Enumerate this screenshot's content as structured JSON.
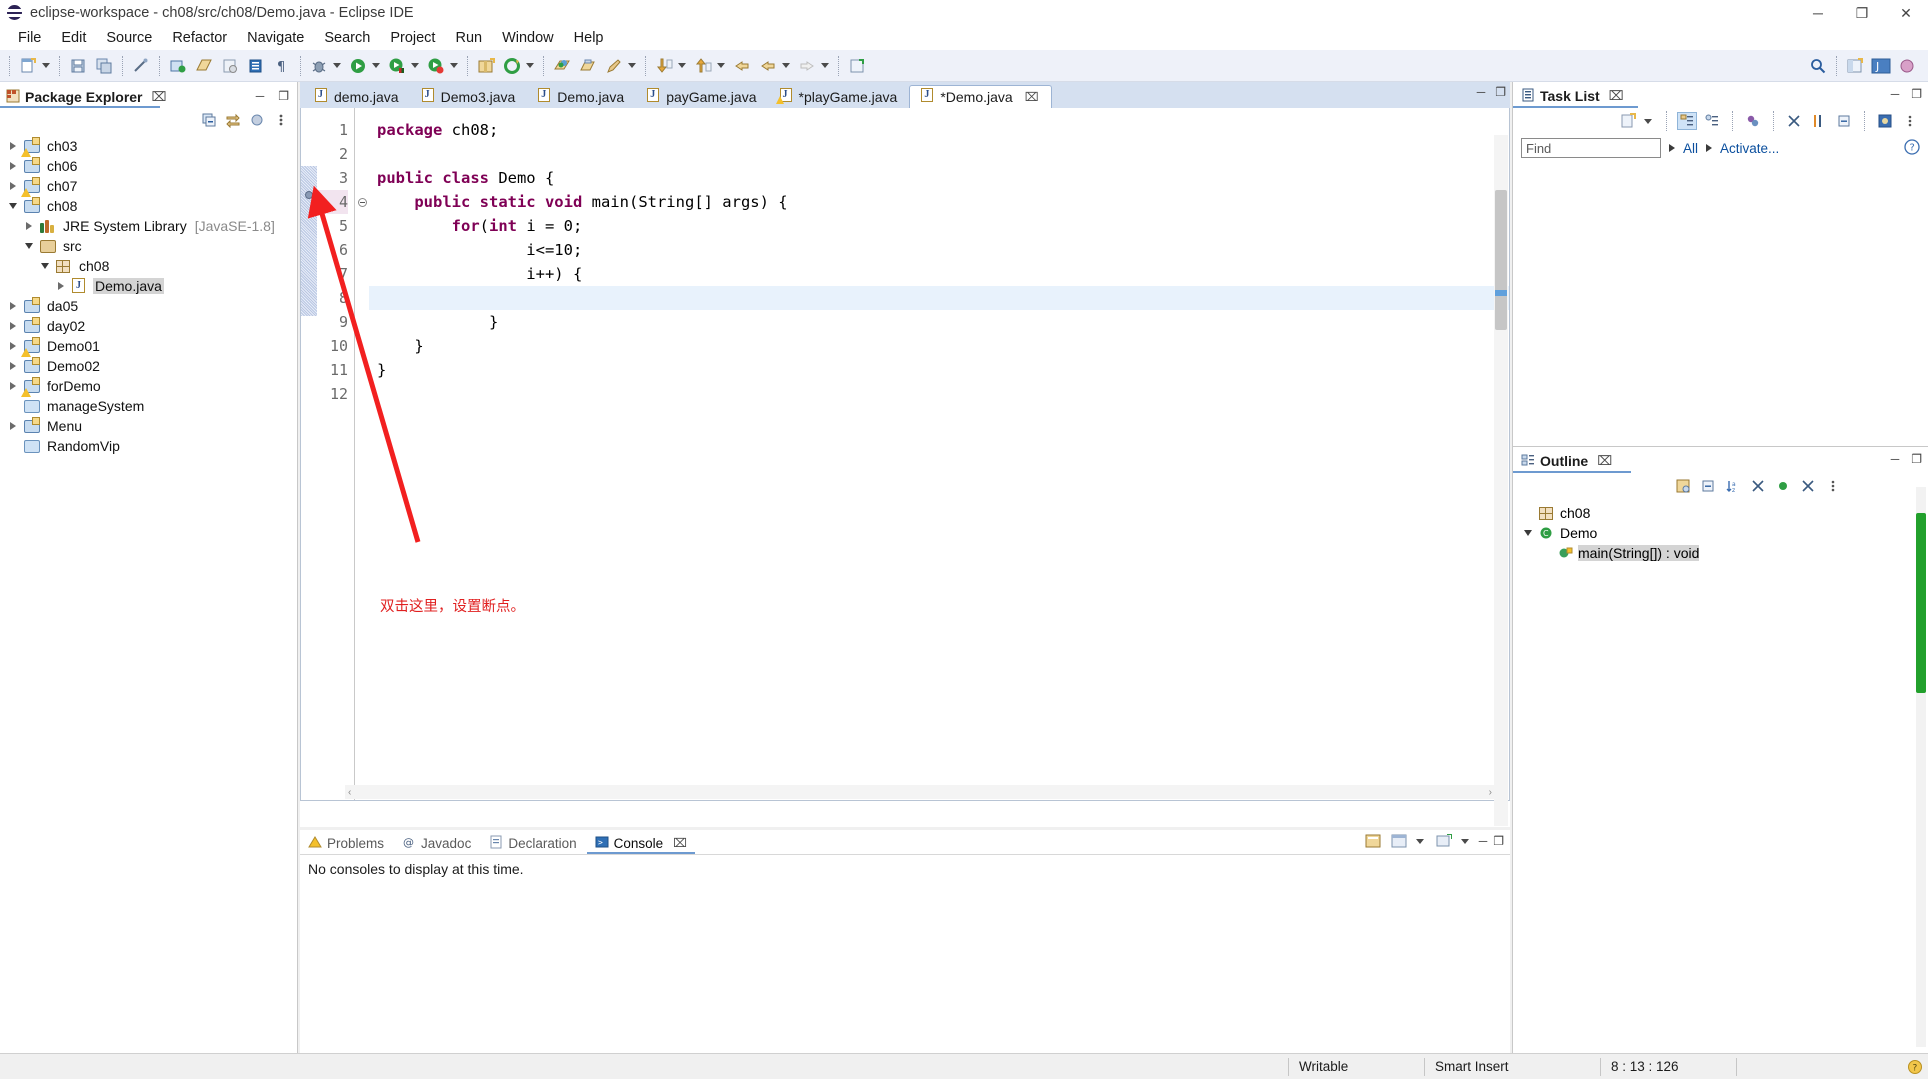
{
  "window": {
    "title": "eclipse-workspace - ch08/src/ch08/Demo.java - Eclipse IDE",
    "app_icon": "eclipse-logo-icon",
    "minimize": "─",
    "maximize": "❐",
    "close": "✕"
  },
  "menubar": {
    "items": [
      "File",
      "Edit",
      "Source",
      "Refactor",
      "Navigate",
      "Search",
      "Project",
      "Run",
      "Window",
      "Help"
    ]
  },
  "toolbar": {
    "groups": [
      {
        "items": [
          {
            "name": "new-wizard-icon",
            "glyph": "▤"
          },
          {
            "name": "new-dropdown-arrow",
            "glyph": ""
          }
        ]
      },
      {
        "items": [
          {
            "name": "save-icon",
            "glyph": "Ὃe"
          },
          {
            "name": "save-all-icon",
            "glyph": "❐"
          }
        ]
      },
      {
        "items": [
          {
            "name": "link-editor-icon",
            "glyph": "✒"
          }
        ]
      },
      {
        "items": [
          {
            "name": "new-java-project-icon",
            "glyph": "▦"
          },
          {
            "name": "new-package-icon",
            "glyph": "▧"
          },
          {
            "name": "new-class-icon",
            "glyph": "Ⓒ"
          },
          {
            "name": "new-junit-icon",
            "glyph": "▨"
          },
          {
            "name": "new-annotation-icon",
            "glyph": "¶"
          }
        ]
      },
      {
        "items": [
          {
            "name": "debug-icon",
            "glyph": "✹"
          },
          {
            "name": "debug-dropdown-arrow",
            "glyph": ""
          },
          {
            "name": "run-icon",
            "glyph": "▶"
          },
          {
            "name": "run-dropdown-arrow",
            "glyph": ""
          },
          {
            "name": "run-as-icon",
            "glyph": "▶"
          },
          {
            "name": "run-as-dropdown-arrow",
            "glyph": ""
          },
          {
            "name": "coverage-icon",
            "glyph": "▶"
          },
          {
            "name": "coverage-dropdown-arrow",
            "glyph": ""
          }
        ]
      },
      {
        "items": [
          {
            "name": "new-package-box-icon",
            "glyph": "❐"
          },
          {
            "name": "external-tools-icon",
            "glyph": "↻"
          },
          {
            "name": "external-tools-dropdown-arrow",
            "glyph": ""
          }
        ]
      },
      {
        "items": [
          {
            "name": "open-type-icon",
            "glyph": "◐"
          },
          {
            "name": "open-task-icon",
            "glyph": "❑"
          },
          {
            "name": "edit-icon",
            "glyph": "✎"
          },
          {
            "name": "edit-dropdown-arrow",
            "glyph": ""
          }
        ]
      },
      {
        "items": [
          {
            "name": "next-annotation-icon",
            "glyph": "↓"
          },
          {
            "name": "next-annotation-dropdown-arrow",
            "glyph": ""
          },
          {
            "name": "previous-annotation-icon",
            "glyph": "↑"
          },
          {
            "name": "previous-annotation-dropdown-arrow",
            "glyph": ""
          }
        ]
      },
      {
        "items": [
          {
            "name": "last-edit-location-icon",
            "glyph": "↩"
          },
          {
            "name": "back-icon",
            "glyph": "←"
          },
          {
            "name": "back-dropdown-arrow",
            "glyph": ""
          },
          {
            "name": "forward-icon",
            "glyph": "→"
          },
          {
            "name": "forward-dropdown-arrow",
            "glyph": ""
          }
        ]
      },
      {
        "items": [
          {
            "name": "pin-editor-icon",
            "glyph": "▣"
          }
        ]
      }
    ],
    "right": [
      {
        "name": "quick-access-search-icon",
        "glyph": "⌕"
      },
      {
        "name": "open-perspective-icon",
        "glyph": "❐"
      },
      {
        "name": "java-perspective-icon",
        "glyph": "J"
      },
      {
        "name": "java-ee-perspective-icon",
        "glyph": "✦"
      }
    ]
  },
  "package_explorer": {
    "tab_label": "Package Explorer",
    "tab_icon": "package-explorer-icon",
    "close_glyph": "⌧",
    "tools": [
      {
        "name": "collapse-all-icon",
        "glyph": "⊟"
      },
      {
        "name": "link-with-editor-icon",
        "glyph": "⇄"
      },
      {
        "name": "focus-on-active-task-icon",
        "glyph": "◉"
      },
      {
        "name": "view-menu-icon",
        "glyph": "⋮"
      }
    ],
    "minimize_glyph": "─",
    "maximize_glyph": "❐",
    "tree": [
      {
        "label": "ch03",
        "icon": "java-project-warning-icon",
        "indent": 0,
        "twist": "collapsed",
        "warn": true
      },
      {
        "label": "ch06",
        "icon": "java-project-icon",
        "indent": 0,
        "twist": "collapsed",
        "warn": false
      },
      {
        "label": "ch07",
        "icon": "java-project-warning-icon",
        "indent": 0,
        "twist": "collapsed",
        "warn": true
      },
      {
        "label": "ch08",
        "icon": "java-project-icon",
        "indent": 0,
        "twist": "expanded",
        "warn": false
      },
      {
        "label": "JRE System Library",
        "suffix": "[JavaSE-1.8]",
        "icon": "jre-library-icon",
        "indent": 1,
        "twist": "collapsed",
        "warn": false
      },
      {
        "label": "src",
        "icon": "source-folder-icon",
        "indent": 1,
        "twist": "expanded",
        "warn": false
      },
      {
        "label": "ch08",
        "icon": "package-icon",
        "indent": 2,
        "twist": "expanded",
        "warn": false
      },
      {
        "label": "Demo.java",
        "icon": "java-file-icon",
        "indent": 3,
        "twist": "collapsed",
        "warn": false,
        "selected": true
      },
      {
        "label": "da05",
        "icon": "java-project-icon",
        "indent": 0,
        "twist": "collapsed",
        "warn": false
      },
      {
        "label": "day02",
        "icon": "java-project-icon",
        "indent": 0,
        "twist": "collapsed",
        "warn": false
      },
      {
        "label": "Demo01",
        "icon": "java-project-warning-icon",
        "indent": 0,
        "twist": "collapsed",
        "warn": true
      },
      {
        "label": "Demo02",
        "icon": "java-project-icon",
        "indent": 0,
        "twist": "collapsed",
        "warn": false
      },
      {
        "label": "forDemo",
        "icon": "java-project-warning-icon",
        "indent": 0,
        "twist": "collapsed",
        "warn": true
      },
      {
        "label": "manageSystem",
        "icon": "closed-project-icon",
        "indent": 0,
        "twist": "none",
        "warn": false
      },
      {
        "label": "Menu",
        "icon": "java-project-icon",
        "indent": 0,
        "twist": "collapsed",
        "warn": false
      },
      {
        "label": "RandomVip",
        "icon": "closed-project-icon",
        "indent": 0,
        "twist": "none",
        "warn": false
      }
    ]
  },
  "editor": {
    "tabs": [
      {
        "label": "demo.java",
        "icon": "java-file-icon",
        "active": false,
        "dirty": false,
        "warn": false
      },
      {
        "label": "Demo3.java",
        "icon": "java-file-icon",
        "active": false,
        "dirty": false,
        "warn": false
      },
      {
        "label": "Demo.java",
        "icon": "java-file-icon",
        "active": false,
        "dirty": false,
        "warn": false
      },
      {
        "label": "payGame.java",
        "icon": "java-file-icon",
        "active": false,
        "dirty": false,
        "warn": false
      },
      {
        "label": "*playGame.java",
        "icon": "java-file-warning-icon",
        "active": false,
        "dirty": true,
        "warn": true
      },
      {
        "label": "*Demo.java",
        "icon": "java-file-icon",
        "active": true,
        "dirty": true,
        "warn": false
      }
    ],
    "active_close_glyph": "⌧",
    "minimize_glyph": "─",
    "maximize_glyph": "❐",
    "line_numbers": [
      "1",
      "2",
      "3",
      "4",
      "5",
      "6",
      "7",
      "8",
      "9",
      "10",
      "11",
      "12"
    ],
    "lines": [
      {
        "n": 1,
        "segments": [
          {
            "t": "package",
            "k": "kw"
          },
          {
            "t": " ch08;",
            "k": "plain"
          }
        ]
      },
      {
        "n": 2,
        "segments": [
          {
            "t": "",
            "k": "plain"
          }
        ]
      },
      {
        "n": 3,
        "segments": [
          {
            "t": "public class",
            "k": "kw"
          },
          {
            "t": " Demo {",
            "k": "plain"
          }
        ]
      },
      {
        "n": 4,
        "segments": [
          {
            "t": "    ",
            "k": "plain"
          },
          {
            "t": "public static void",
            "k": "kw"
          },
          {
            "t": " main(",
            "k": "plain"
          },
          {
            "t": "String",
            "k": "plain"
          },
          {
            "t": "[] args) {",
            "k": "plain"
          }
        ]
      },
      {
        "n": 5,
        "segments": [
          {
            "t": "        ",
            "k": "plain"
          },
          {
            "t": "for",
            "k": "kw"
          },
          {
            "t": "(",
            "k": "plain"
          },
          {
            "t": "int",
            "k": "kw"
          },
          {
            "t": " i = 0;",
            "k": "plain"
          }
        ]
      },
      {
        "n": 6,
        "segments": [
          {
            "t": "                i<=10;",
            "k": "plain"
          }
        ]
      },
      {
        "n": 7,
        "segments": [
          {
            "t": "                i++) {",
            "k": "plain"
          }
        ]
      },
      {
        "n": 8,
        "segments": [
          {
            "t": "",
            "k": "plain"
          }
        ],
        "current": true
      },
      {
        "n": 9,
        "segments": [
          {
            "t": "            }",
            "k": "plain"
          }
        ]
      },
      {
        "n": 10,
        "segments": [
          {
            "t": "    }",
            "k": "plain"
          }
        ]
      },
      {
        "n": 11,
        "segments": [
          {
            "t": "}",
            "k": "plain"
          }
        ]
      },
      {
        "n": 12,
        "segments": [
          {
            "t": "",
            "k": "plain"
          }
        ]
      }
    ],
    "breakpoint_line": 5,
    "folded_line": 4
  },
  "annotation": {
    "text": "双击这里，设置断点。",
    "color": "#e02020",
    "arrow_name": "red-arrow-annotation"
  },
  "console_panel": {
    "tabs": [
      {
        "label": "Problems",
        "icon": "problems-icon",
        "active": false
      },
      {
        "label": "Javadoc",
        "icon": "javadoc-icon",
        "active": false
      },
      {
        "label": "Declaration",
        "icon": "declaration-icon",
        "active": false
      },
      {
        "label": "Console",
        "icon": "console-icon",
        "active": true
      }
    ],
    "close_glyph": "⌧",
    "message": "No consoles to display at this time.",
    "tools": [
      {
        "name": "open-console-icon",
        "glyph": "▤"
      },
      {
        "name": "open-console-dropdown-arrow",
        "glyph": ""
      },
      {
        "name": "pin-console-icon",
        "glyph": "▣"
      },
      {
        "name": "new-console-view-icon",
        "glyph": "⊞"
      },
      {
        "name": "new-console-dropdown-arrow",
        "glyph": ""
      },
      {
        "name": "minimize-icon",
        "glyph": "─"
      },
      {
        "name": "maximize-icon",
        "glyph": "❐"
      }
    ]
  },
  "task_list": {
    "tab_label": "Task List",
    "tab_icon": "task-list-icon",
    "close_glyph": "⌧",
    "minimize_glyph": "─",
    "maximize_glyph": "❐",
    "tools": [
      {
        "name": "new-task-icon",
        "glyph": "❐"
      },
      {
        "name": "new-task-dropdown-arrow",
        "glyph": ""
      },
      {
        "name": "categorized-presentation-icon",
        "glyph": "☷"
      },
      {
        "name": "scheduled-presentation-icon",
        "glyph": "☰"
      },
      {
        "name": "focus-on-workweek-icon",
        "glyph": "●"
      },
      {
        "name": "filter-completed-tasks-icon",
        "glyph": "✗"
      },
      {
        "name": "synchronize-changed-icon",
        "glyph": "⇅"
      },
      {
        "name": "collapse-all-icon",
        "glyph": "⊟"
      },
      {
        "name": "restore-tasks-icon",
        "glyph": "▩"
      },
      {
        "name": "view-menu-icon",
        "glyph": "⋮"
      }
    ],
    "find_placeholder": "Find",
    "filter_all": "All",
    "filter_activate": "Activate...",
    "help_glyph": "?"
  },
  "outline": {
    "tab_label": "Outline",
    "tab_icon": "outline-icon",
    "close_glyph": "⌧",
    "minimize_glyph": "─",
    "maximize_glyph": "❐",
    "tools": [
      {
        "name": "focus-on-active-task-icon",
        "glyph": "◉"
      },
      {
        "name": "collapse-all-icon",
        "glyph": "⊟"
      },
      {
        "name": "sort-icon",
        "glyph": "⇅"
      },
      {
        "name": "hide-fields-icon",
        "glyph": "✗"
      },
      {
        "name": "hide-static-icon",
        "glyph": "●"
      },
      {
        "name": "hide-non-public-icon",
        "glyph": "✖"
      },
      {
        "name": "view-menu-icon",
        "glyph": "⋮"
      }
    ],
    "items": [
      {
        "label": "ch08",
        "icon": "package-icon",
        "indent": 0,
        "twist": "none",
        "selected": false
      },
      {
        "label": "Demo",
        "icon": "java-class-icon",
        "indent": 0,
        "twist": "expanded",
        "selected": false
      },
      {
        "label": "main(String[]) : void",
        "icon": "public-static-method-icon",
        "indent": 1,
        "twist": "none",
        "selected": true
      }
    ]
  },
  "statusbar": {
    "writable": "Writable",
    "insert_mode": "Smart Insert",
    "position": "8 : 13 : 126",
    "help_glyph": "?"
  }
}
